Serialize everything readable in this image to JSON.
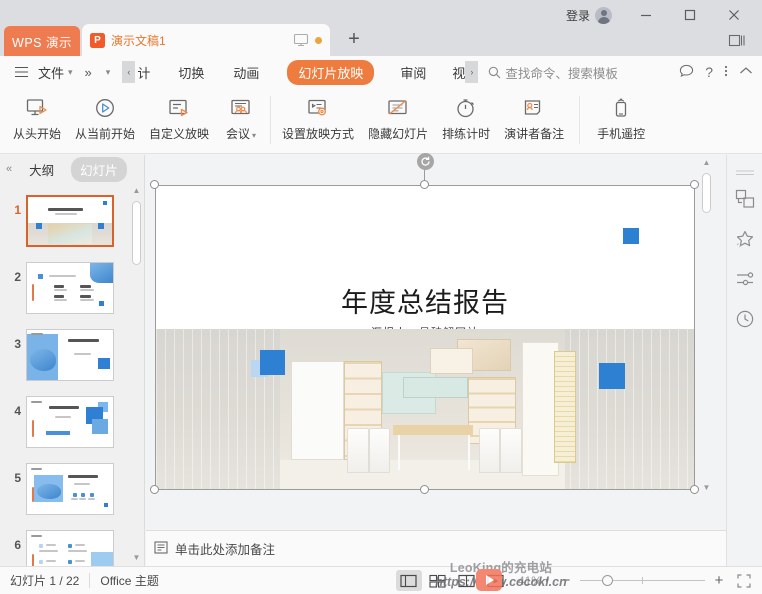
{
  "titlebar": {
    "wps_badge": "WPS 演示",
    "doc_tab": {
      "label": "演示文稿1",
      "icon_letter": "P"
    },
    "new_tab": "+",
    "login_label": "登录",
    "window_buttons": [
      "minimize",
      "maximize",
      "close"
    ]
  },
  "menubar": {
    "file_label": "文件",
    "overflow": "»",
    "truncated_left": "计",
    "tabs": [
      {
        "label": "切换",
        "active": false
      },
      {
        "label": "动画",
        "active": false
      },
      {
        "label": "幻灯片放映",
        "active": true
      },
      {
        "label": "审阅",
        "active": false
      },
      {
        "label": "视",
        "active": false
      }
    ],
    "search_placeholder": "查找命令、搜索模板",
    "right_icons": [
      "comment-icon",
      "help-icon",
      "more-icon",
      "collapse-ribbon-icon"
    ]
  },
  "ribbon": {
    "groups": [
      {
        "buttons": [
          {
            "label": "从头开始",
            "icon": "play-from-start-icon",
            "dropdown": false
          },
          {
            "label": "从当前开始",
            "icon": "play-from-current-icon",
            "dropdown": false
          },
          {
            "label": "自定义放映",
            "icon": "custom-show-icon",
            "dropdown": false
          },
          {
            "label": "会议",
            "icon": "meeting-icon",
            "dropdown": true
          }
        ]
      },
      {
        "buttons": [
          {
            "label": "设置放映方式",
            "icon": "setup-show-icon",
            "dropdown": false
          },
          {
            "label": "隐藏幻灯片",
            "icon": "hide-slide-icon",
            "dropdown": false
          },
          {
            "label": "排练计时",
            "icon": "rehearse-timing-icon",
            "dropdown": false
          },
          {
            "label": "演讲者备注",
            "icon": "presenter-notes-icon",
            "dropdown": false
          }
        ]
      },
      {
        "buttons": [
          {
            "label": "手机遥控",
            "icon": "phone-remote-icon",
            "dropdown": false
          }
        ]
      }
    ]
  },
  "left_panel": {
    "collapse_icon": "«",
    "tabs": [
      {
        "label": "大纲",
        "active": false
      },
      {
        "label": "幻灯片",
        "active": true
      }
    ],
    "thumbnails": [
      {
        "number": "1",
        "selected": true,
        "layout": "title-photo"
      },
      {
        "number": "2",
        "selected": false,
        "layout": "agenda"
      },
      {
        "number": "3",
        "selected": false,
        "layout": "blob-left"
      },
      {
        "number": "4",
        "selected": false,
        "layout": "squares-right"
      },
      {
        "number": "5",
        "selected": false,
        "layout": "blob-icons"
      },
      {
        "number": "6",
        "selected": false,
        "layout": "icon-grid"
      }
    ]
  },
  "slide": {
    "title": "年度总结报告",
    "subtitle": "汇报人：易破解网站",
    "decoration_color": "#2e80d3",
    "selected": true,
    "rotate_handle": "rotate-icon"
  },
  "notes": {
    "icon": "notes-icon",
    "placeholder": "单击此处添加备注"
  },
  "right_sidebar": {
    "icons": [
      "divider-lines-icon",
      "shape-transform-icon",
      "effects-star-icon",
      "adjust-sliders-icon",
      "history-clock-icon"
    ]
  },
  "statusbar": {
    "slide_counter": "幻灯片 1 / 22",
    "theme": "Office 主题",
    "view_buttons": [
      "normal-view-icon",
      "slide-sorter-icon",
      "reading-view-icon",
      "slideshow-icon"
    ],
    "active_view": "normal-view-icon",
    "zoom_value": "41%",
    "zoom_caret": "▾",
    "zoom_out": "−",
    "zoom_in": "+",
    "fit_icon": "fit-to-window-icon"
  },
  "watermark": {
    "line1": "LeoKing的充电站",
    "line2": "https://www.cocokl.cn",
    "logo": "play-logo"
  }
}
